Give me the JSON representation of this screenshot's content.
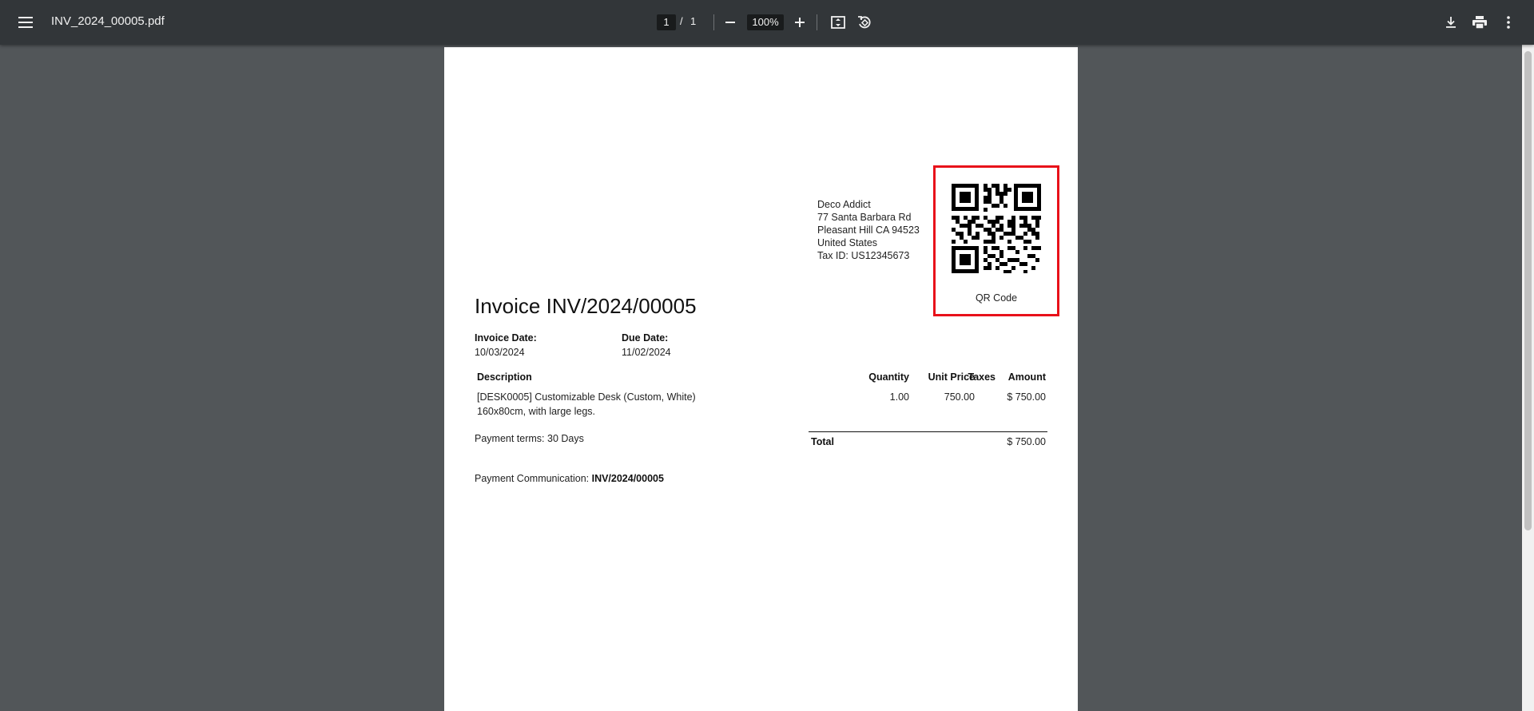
{
  "toolbar": {
    "menu_icon": "hamburger-menu-icon",
    "title": "INV_2024_00005.pdf",
    "page_current": "1",
    "page_sep": "/",
    "page_total": "1",
    "zoom": "100%",
    "icons": [
      "zoom-out-icon",
      "zoom-in-icon",
      "fit-page-icon",
      "rotate-icon",
      "download-icon",
      "print-icon",
      "more-vert-icon"
    ]
  },
  "invoice": {
    "address": {
      "line1": "Deco Addict",
      "line2": "77 Santa Barbara Rd",
      "line3": "Pleasant Hill CA 94523",
      "line4": "United States",
      "line5": "Tax ID: US12345673"
    },
    "qr_label": "QR Code",
    "highlight_color": "#e8111a",
    "title": "Invoice INV/2024/00005",
    "invoice_date_label": "Invoice Date:",
    "invoice_date": "10/03/2024",
    "due_date_label": "Due Date:",
    "due_date": "11/02/2024",
    "columns": {
      "description": "Description",
      "quantity": "Quantity",
      "unit_price": "Unit Price",
      "taxes": "Taxes",
      "amount": "Amount"
    },
    "line": {
      "description_1": "[DESK0005] Customizable Desk (Custom, White)",
      "description_2": "160x80cm, with large legs.",
      "quantity": "1.00",
      "unit_price": "750.00",
      "taxes": "",
      "amount": "$ 750.00"
    },
    "payment_terms": "Payment terms: 30 Days",
    "total_label": "Total",
    "total": "$ 750.00",
    "payment_comm_label": "Payment Communication:",
    "payment_comm_value": "INV/2024/00005"
  }
}
